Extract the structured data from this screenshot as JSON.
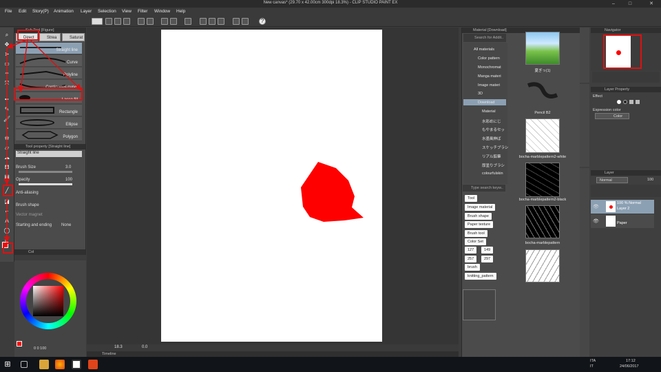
{
  "window": {
    "title": "New canvas* (29.70 x 42.00cm 300dpi 18.3%) - CLIP STUDIO PAINT EX",
    "controls": [
      "–",
      "□",
      "✕"
    ]
  },
  "menu": [
    "File",
    "Edit",
    "Story(P)",
    "Animation",
    "Layer",
    "Selection",
    "View",
    "Filter",
    "Window",
    "Help"
  ],
  "subtool": {
    "header": "Sub Tool [Figure]",
    "tabs": [
      "Direct",
      "Strea",
      "Saturat"
    ],
    "items": [
      "Straight line",
      "Curve",
      "Polyline",
      "Continuous curve",
      "Lasso fill",
      "Rectangle",
      "Ellipse",
      "Polygon"
    ]
  },
  "tool_property": {
    "header": "Tool property [Straight line]",
    "name": "Straight line",
    "brush_size_label": "Brush Size",
    "brush_size_value": "3.0",
    "opacity_label": "Opacity",
    "opacity_value": "100",
    "antialias_label": "Anti-aliasing",
    "brush_shape_label": "Brush shape",
    "vector_magnet_label": "Vector magnet",
    "start_end_label": "Starting and ending",
    "start_end_value": "None"
  },
  "color_panel": {
    "tab": "Col",
    "values": "0   0   100"
  },
  "canvas": {
    "zoom": "18.3",
    "angle": "0.0",
    "shape_color": "#ff0000"
  },
  "timeline": {
    "label": "Timeline"
  },
  "material": {
    "header": "Material [Download]",
    "search_placeholder": "Search for Addit..",
    "tree": [
      "All materials",
      "Color pattern",
      "Monochromat",
      "Manga materi",
      "Image materi",
      "3D",
      "Download",
      "Material",
      "水彩めにじ",
      "もやまるセッ",
      "水墨風伸ば",
      "スケッチブラシ",
      "リアル鉛筆",
      "厚塗りブラシ",
      "colourfulskin"
    ],
    "tag_search_placeholder": "Type search keyw..",
    "tags": [
      "Tool",
      "Image material",
      "Brush shape",
      "Paper texture",
      "Brush tool",
      "Color Set",
      "127",
      "149",
      "257",
      "297",
      "brush",
      "knitting_pattern"
    ],
    "items": [
      "夏ぎっ(1)",
      "Pencil B2",
      "bocha-marblepattern2-white",
      "bocha-marblepattern2-black",
      "bocha-marblepattern"
    ]
  },
  "navigator": {
    "header": "Navigator"
  },
  "layer_property": {
    "header": "Layer Property",
    "effect_label": "Effect",
    "expression_label": "Expression color",
    "expression_value": "Color"
  },
  "layers": {
    "header": "Layer",
    "blend": "Normal",
    "opacity": "100",
    "items": [
      {
        "meta": "100 % Normal",
        "name": "Layer 2"
      },
      {
        "meta": "",
        "name": "Paper"
      }
    ]
  },
  "taskbar": {
    "lang1": "ITA",
    "lang2": "IT",
    "time": "17:12",
    "date": "24/06/2017"
  },
  "colors": {
    "annotation": "#e01010",
    "accent_selected": "#8ca0b3",
    "main_color": "#ff0000"
  }
}
